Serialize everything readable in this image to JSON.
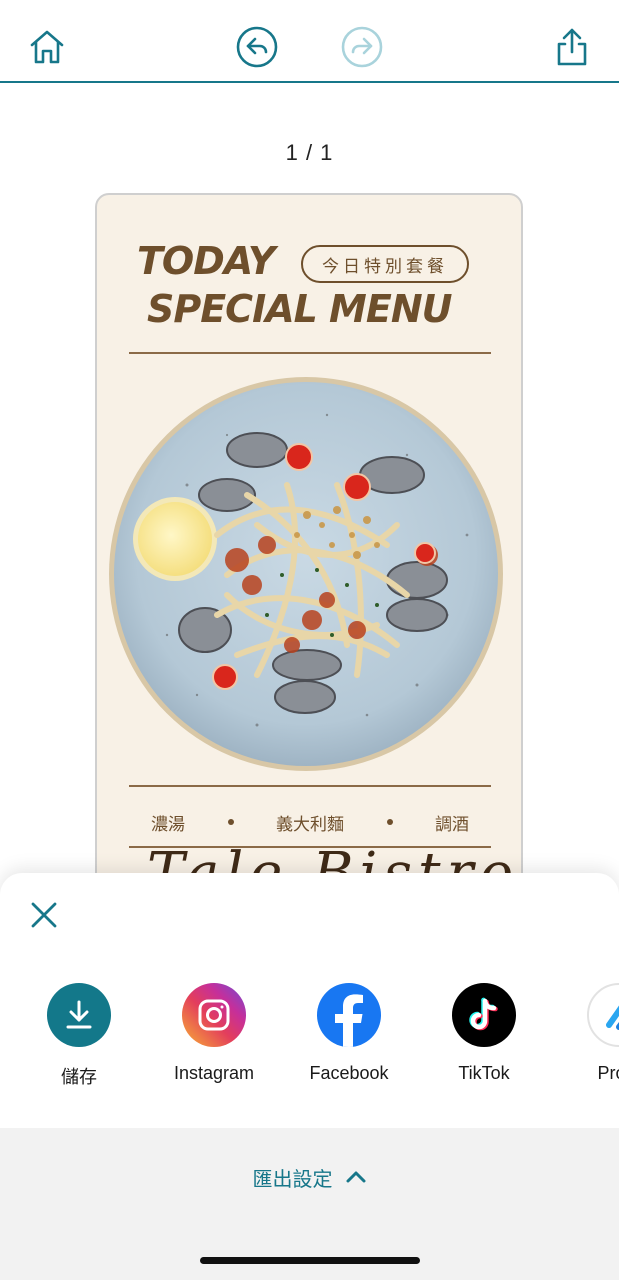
{
  "toolbar": {
    "home_icon": "home-icon",
    "undo_icon": "undo-icon",
    "redo_icon": "redo-icon",
    "share_icon": "share-icon",
    "accent": "#17778a"
  },
  "page_counter": "1 / 1",
  "card": {
    "title_line1": "TODAY",
    "title_line2": "SPECIAL MENU",
    "pill_text": "今日特別套餐",
    "categories": [
      "濃湯",
      "義大利麵",
      "調酒"
    ],
    "script_text": "Tale Bistro",
    "text_color": "#6e4f2c",
    "bg_color": "#f8f1e6"
  },
  "share_sheet": {
    "close_icon": "close-icon",
    "items": [
      {
        "label": "儲存",
        "icon": "download-icon"
      },
      {
        "label": "Instagram",
        "icon": "instagram-icon"
      },
      {
        "label": "Facebook",
        "icon": "facebook-icon"
      },
      {
        "label": "TikTok",
        "icon": "tiktok-icon"
      },
      {
        "label": "Prom",
        "icon": "promeo-icon"
      }
    ],
    "export_label": "匯出設定",
    "export_icon": "chevron-up-icon"
  }
}
